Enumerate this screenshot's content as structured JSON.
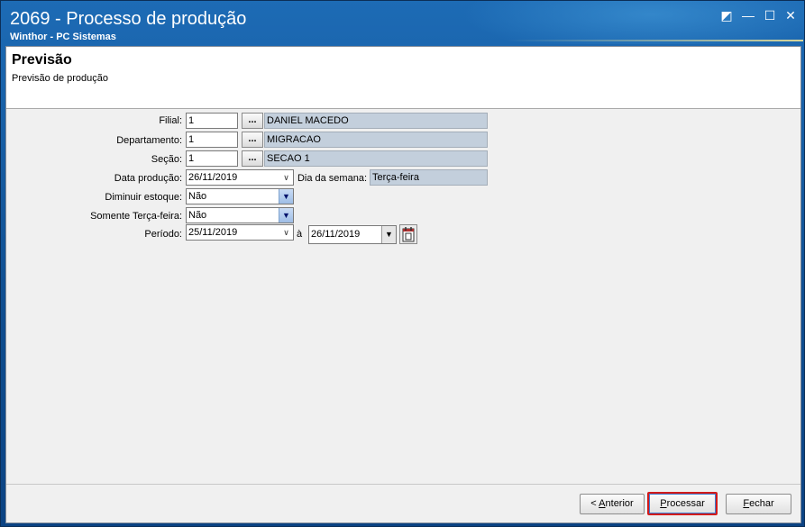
{
  "window": {
    "title": "2069 - Processo de produção",
    "subtitle": "Winthor - PC Sistemas",
    "controls": {
      "restore": "◩",
      "minimize": "—",
      "maximize": "☐",
      "close": "✕"
    }
  },
  "header": {
    "title": "Previsão",
    "subtitle": "Previsão de produção"
  },
  "form": {
    "filial": {
      "label": "Filial:",
      "code": "1",
      "lookup": "...",
      "name": "DANIEL MACEDO"
    },
    "departamento": {
      "label": "Departamento:",
      "code": "1",
      "lookup": "...",
      "name": "MIGRACAO"
    },
    "secao": {
      "label": "Seção:",
      "code": "1",
      "lookup": "...",
      "name": "SECAO 1"
    },
    "data_producao": {
      "label": "Data produção:",
      "value": "26/11/2019"
    },
    "dia_semana": {
      "label": "Dia da semana:",
      "value": "Terça-feira"
    },
    "diminuir_estoque": {
      "label": "Diminuir estoque:",
      "value": "Não"
    },
    "somente_terca": {
      "label": "Somente Terça-feira:",
      "value": "Não"
    },
    "periodo": {
      "label": "Período:",
      "start": "25/11/2019",
      "separator": "à",
      "end": "26/11/2019"
    }
  },
  "buttons": {
    "anterior": {
      "prefix": "< ",
      "accel": "A",
      "rest": "nterior"
    },
    "processar": {
      "accel": "P",
      "rest": "rocessar"
    },
    "fechar": {
      "accel": "F",
      "rest": "echar"
    }
  },
  "icons": {
    "dropdown": "chevron-down",
    "calendar": "calendar-icon"
  }
}
